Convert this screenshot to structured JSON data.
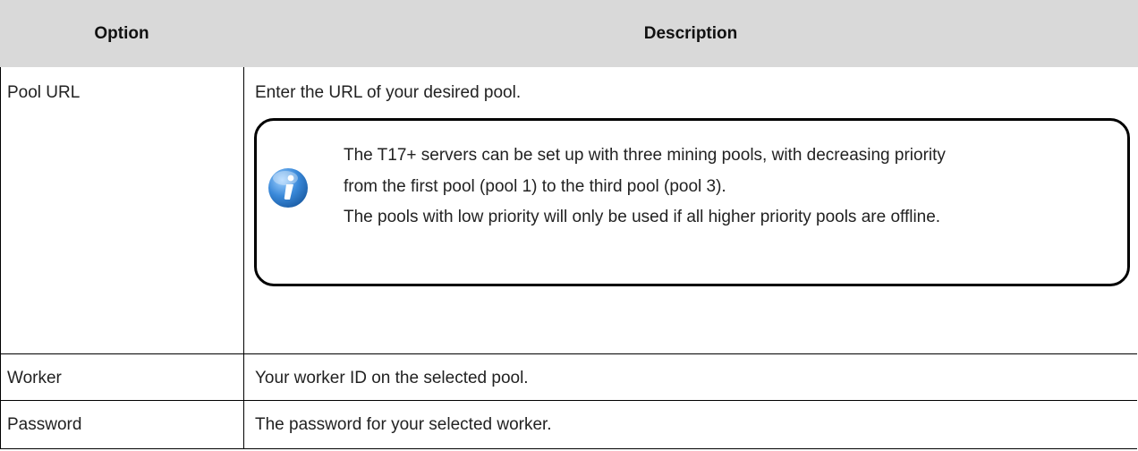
{
  "table": {
    "headers": {
      "option": "Option",
      "description": "Description"
    },
    "rows": [
      {
        "option": "Pool URL",
        "description": "Enter the URL of your desired pool.",
        "note": {
          "icon": "info-icon",
          "lines": [
            "The T17+ servers can be set up with three mining pools, with decreasing priority",
            "from the first pool (pool 1) to the third pool (pool 3).",
            "The pools with low priority will only be used if all higher priority pools are offline."
          ]
        }
      },
      {
        "option": "Worker",
        "description": "Your worker ID on the selected pool."
      },
      {
        "option": "Password",
        "description": "The password for your selected worker."
      }
    ]
  },
  "colors": {
    "header_bg": "#d9d9d9",
    "border": "#000000",
    "icon_blue": "#2f7fd0"
  }
}
